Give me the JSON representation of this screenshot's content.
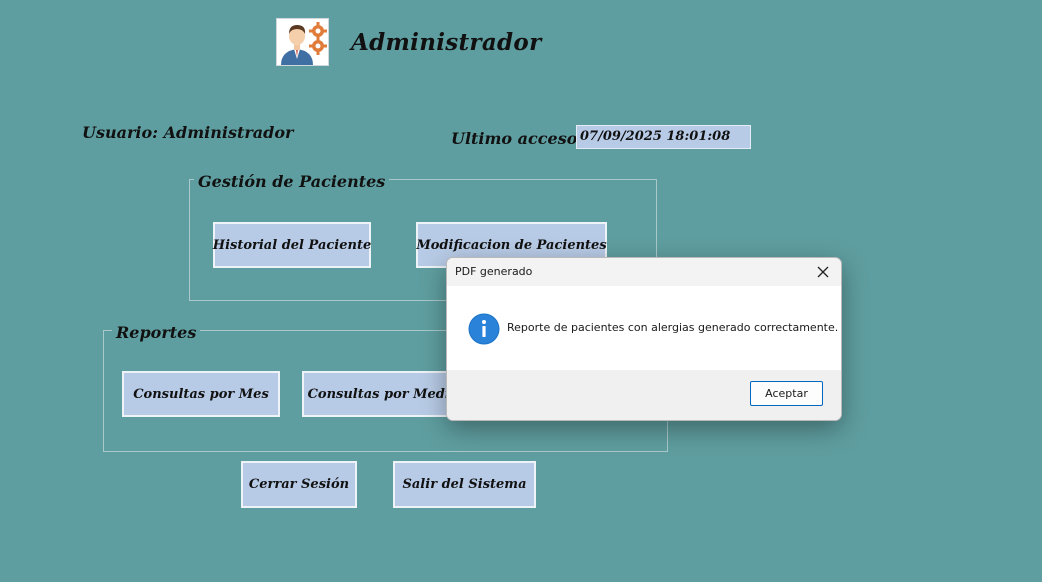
{
  "header": {
    "title": "Administrador",
    "avatar_icon": "admin-user-gears-icon"
  },
  "user": {
    "label": "Usuario: Administrador"
  },
  "access": {
    "label": "Ultimo acceso:",
    "value": "07/09/2025 18:01:08"
  },
  "patients_group": {
    "title": "Gestión de Pacientes",
    "buttons": [
      "Historial del Paciente",
      "Modificacion de Pacientes"
    ]
  },
  "reports_group": {
    "title": "Reportes",
    "buttons": [
      "Consultas por Mes",
      "Consultas por Medico"
    ]
  },
  "footer_buttons": {
    "logout": "Cerrar Sesión",
    "exit": "Salir del Sistema"
  },
  "dialog": {
    "title": "PDF generado",
    "message": "Reporte de pacientes con alergias generado correctamente.",
    "ok_label": "Aceptar",
    "icon": "info-icon"
  },
  "colors": {
    "background": "#5f9ea0",
    "button": "#b8cbe6",
    "dialog_accent": "#0067c0",
    "info_icon": "#1a73c8"
  }
}
